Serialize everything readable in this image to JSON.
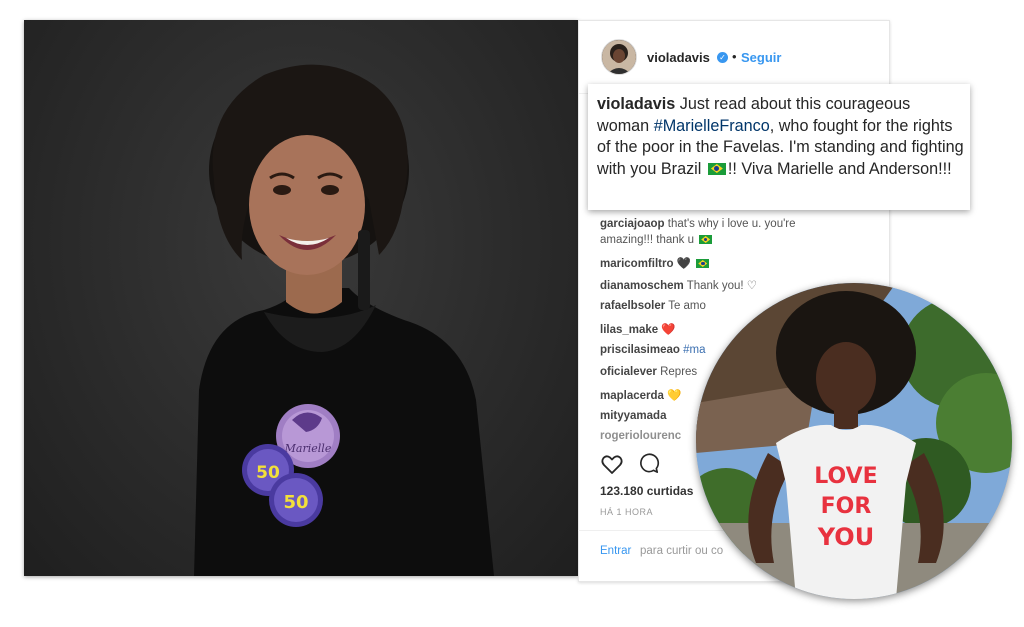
{
  "instagram": {
    "username": "violadavis",
    "verified_mark": "✓",
    "dot": "•",
    "follow_label": "Seguir",
    "caption": {
      "user": "violadavis",
      "text_1": " Just read about this courageous woman ",
      "hashtag": "#MarielleFranco",
      "text_2": ", who fought for the rights of the poor in the Favelas. I'm standing and fighting with you Brazil ",
      "text_3": "!! Viva Marielle and Anderson!!!"
    },
    "comments": [
      {
        "user": "garciajoaop",
        "text": " that's why i love u. you're"
      },
      {
        "user": "",
        "text": "amazing!!! thank u"
      },
      {
        "user": "maricomfiltro",
        "text": " 🖤"
      },
      {
        "user": "dianamoschem",
        "text": " Thank you! ♡"
      },
      {
        "user": "rafaelbsoler",
        "text": " Te amo"
      },
      {
        "user": "lilas_make",
        "text": " ❤️"
      },
      {
        "user": "priscilasimeao",
        "text": " #ma"
      },
      {
        "user": "oficialever",
        "text": " Repres"
      },
      {
        "user": "maplacerda",
        "text": " 💛"
      },
      {
        "user": "mityyamada",
        "text": ""
      },
      {
        "user": "rogeriolourenc",
        "text": ""
      }
    ],
    "likes": "123.180 curtidas",
    "time": "HÁ 1 HORA",
    "login_link": "Entrar",
    "login_rest": "para curtir ou co",
    "icons": {
      "like": "heart-icon",
      "comment": "comment-icon",
      "verified": "verified-badge-icon",
      "flag": "brazil-flag-icon"
    }
  },
  "photos": {
    "left_badge_text": "Marielle",
    "left_badge_number_1": "50",
    "left_badge_number_2": "50",
    "circle_shirt_line_1": "LOVE",
    "circle_shirt_line_2": "FOR",
    "circle_shirt_line_3": "YOU"
  },
  "colors": {
    "accent": "#3897f0",
    "hashtag": "#003569",
    "shirt_text": "#e8323f"
  }
}
